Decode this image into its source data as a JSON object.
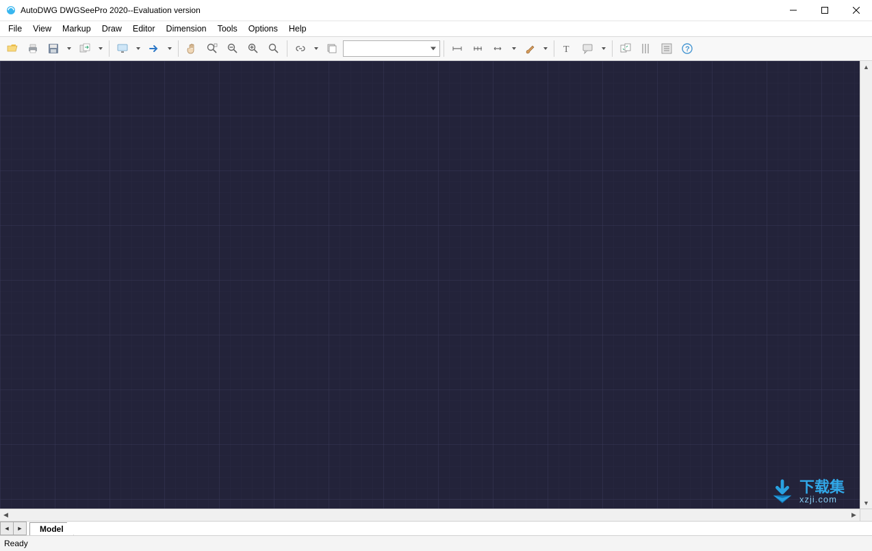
{
  "window": {
    "title": "AutoDWG DWGSeePro 2020--Evaluation version"
  },
  "menubar": {
    "items": [
      "File",
      "View",
      "Markup",
      "Draw",
      "Editor",
      "Dimension",
      "Tools",
      "Options",
      "Help"
    ]
  },
  "toolbar": {
    "layer_select_value": ""
  },
  "tabs": {
    "items": [
      "Model"
    ]
  },
  "status": {
    "text": "Ready"
  },
  "watermark": {
    "line1": "下载集",
    "line2": "xzji.com"
  },
  "colors": {
    "canvas_bg": "#23233a",
    "grid_minor": "#2f2f48",
    "grid_major": "#3a3a58"
  }
}
